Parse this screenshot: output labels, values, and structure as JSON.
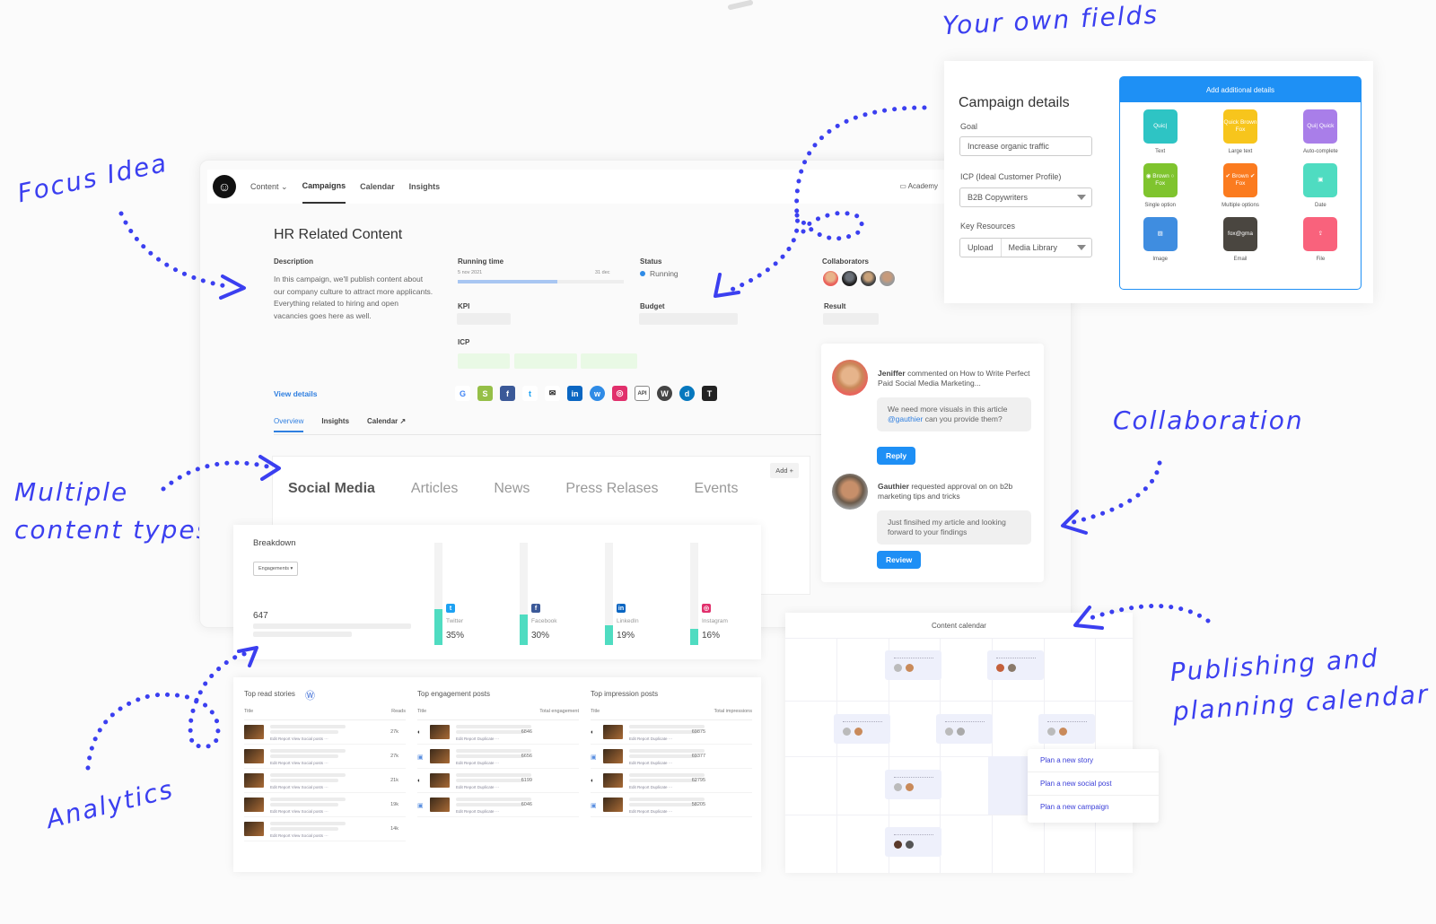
{
  "annotations": {
    "your_own_fields": "Your own fields",
    "focus_idea": "Focus Idea",
    "multiple_content_types_1": "Multiple",
    "multiple_content_types_2": "content types",
    "collaboration": "Collaboration",
    "analytics": "Analytics",
    "publishing_1": "Publishing and",
    "publishing_2": "planning calendar"
  },
  "app": {
    "logo": "☺",
    "nav": {
      "content": "Content ⌄",
      "campaigns": "Campaigns",
      "calendar": "Calendar",
      "insights": "Insights",
      "academy": "▭ Academy"
    },
    "campaign": {
      "title": "HR Related Content",
      "description_label": "Description",
      "description": "In this campaign, we'll publish content about our company culture to attract more applicants. Everything related to hiring and open vacancies goes here as well.",
      "view_details": "View details",
      "running_time_label": "Running time",
      "running_start": "5 nov 2021",
      "running_end": "31 dec",
      "running_progress_pct": 60,
      "status_label": "Status",
      "status_value": "Running",
      "collaborators_label": "Collaborators",
      "kpi_label": "KPI",
      "budget_label": "Budget",
      "result_label": "Result",
      "icp_label": "ICP",
      "channels": [
        "G",
        "S",
        "f",
        "t",
        "✉",
        "in",
        "w",
        "◎",
        "API",
        "W",
        "d",
        "T"
      ]
    },
    "subtabs": {
      "overview": "Overview",
      "insights": "Insights",
      "calendar": "Calendar ↗"
    },
    "content_types": {
      "tabs": [
        "Social Media",
        "Articles",
        "News",
        "Press Relases",
        "Events"
      ],
      "add_button": "Add +"
    }
  },
  "campaign_details": {
    "title": "Campaign details",
    "goal_label": "Goal",
    "goal_value": "Increase organic traffic",
    "icp_label": "ICP (Ideal Customer Profile)",
    "icp_value": "B2B Copywriters",
    "key_resources_label": "Key Resources",
    "upload": "Upload",
    "media_library": "Media Library",
    "add_details_header": "Add additional details",
    "field_types": [
      {
        "name": "Text",
        "sample": "Quic|",
        "color": "#2ec4c4"
      },
      {
        "name": "Large text",
        "sample": "Quick Brown Fox",
        "color": "#f7c51c"
      },
      {
        "name": "Auto-complete",
        "sample": "Qui| Quick",
        "color": "#a97ee9"
      },
      {
        "name": "Single option",
        "sample": "◉ Brown ○ Fox",
        "color": "#7fc42e"
      },
      {
        "name": "Multiple options",
        "sample": "✔ Brown ✔ Fox",
        "color": "#fb7b1f"
      },
      {
        "name": "Date",
        "sample": "▣",
        "color": "#4fdcc1"
      },
      {
        "name": "Image",
        "sample": "▨",
        "color": "#3f8de0"
      },
      {
        "name": "Email",
        "sample": "fox@gma",
        "color": "#4a4640"
      },
      {
        "name": "File",
        "sample": "⇪",
        "color": "#f9627c"
      }
    ]
  },
  "collaboration": {
    "items": [
      {
        "user": "Jeniffer",
        "action": " commented on How to Write Perfect Paid Social Media Marketing...",
        "message_pre": "We need more visuals in this article ",
        "mention": "@gauthier",
        "message_post": " can you provide them?",
        "button": "Reply"
      },
      {
        "user": "Gauthier",
        "action": " requested approval on on b2b marketing tips and tricks",
        "message_pre": "Just finsihed my article and looking forward to your findings",
        "mention": "",
        "message_post": "",
        "button": "Review"
      }
    ]
  },
  "breakdown": {
    "title": "Breakdown",
    "metric_select": "Engagements ▾",
    "total": "647",
    "channels": [
      {
        "name": "Twitter",
        "pct": 35,
        "label": "35%",
        "icon": "t",
        "color": "#1da1f2"
      },
      {
        "name": "Facebook",
        "pct": 30,
        "label": "30%",
        "icon": "f",
        "color": "#3b5998"
      },
      {
        "name": "LinkedIn",
        "pct": 19,
        "label": "19%",
        "icon": "in",
        "color": "#0a66c2"
      },
      {
        "name": "Instagram",
        "pct": 16,
        "label": "16%",
        "icon": "◎",
        "color": "#e1306c"
      }
    ]
  },
  "tables": {
    "top_read": {
      "title": "Top read stories",
      "col_title": "Title",
      "col_value": "Reads",
      "actions": "Edit  Report  View  Social posts  ···",
      "rows": [
        "27k",
        "27k",
        "21k",
        "19k",
        "14k"
      ]
    },
    "top_engagement": {
      "title": "Top engagement posts",
      "col_title": "Title",
      "col_value": "Total engagement",
      "actions": "Edit  Report  Duplicate  ···",
      "rows": [
        "6846",
        "6656",
        "6199",
        "6046"
      ]
    },
    "top_impression": {
      "title": "Top impression posts",
      "col_title": "Title",
      "col_value": "Total impressions",
      "actions": "Edit  Report  Duplicate  ···",
      "rows": [
        "69875",
        "69377",
        "62795",
        "58205"
      ]
    }
  },
  "calendar": {
    "title": "Content calendar",
    "menu": [
      "Plan a new story",
      "Plan a new social post",
      "Plan a new campaign"
    ]
  }
}
